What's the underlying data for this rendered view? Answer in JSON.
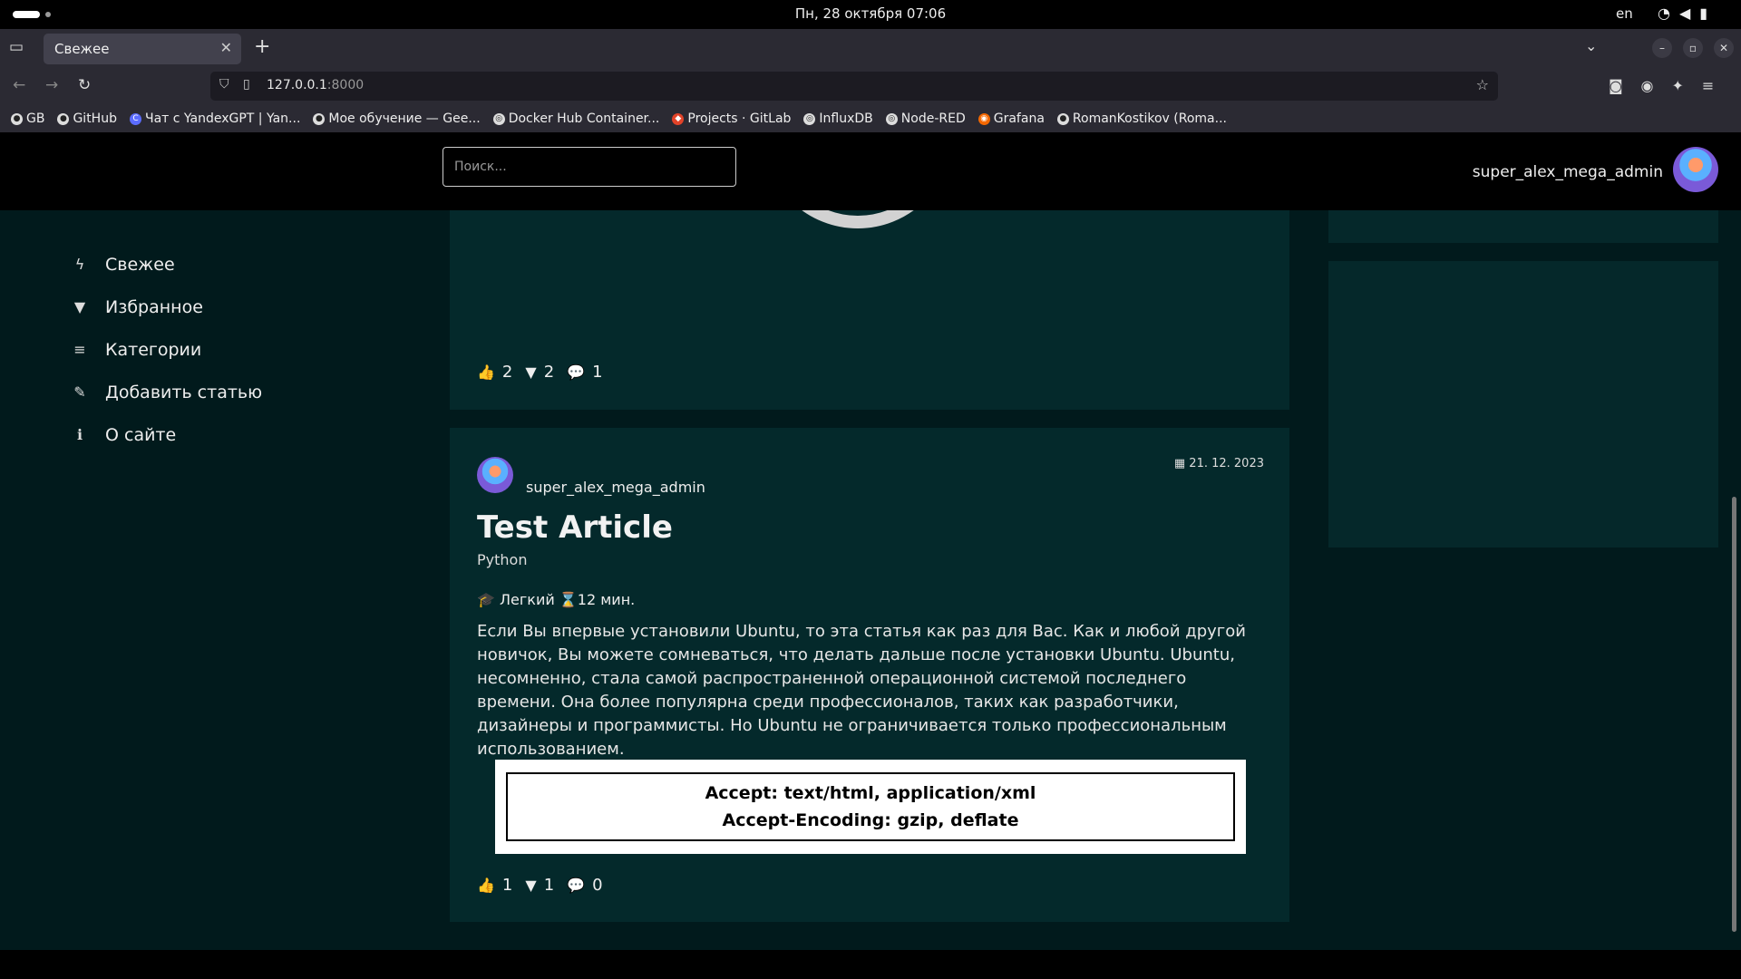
{
  "os": {
    "datetime": "Пн, 28 октября  07:06",
    "lang": "en"
  },
  "browser": {
    "tab_title": "Свежее",
    "url_host": "127.0.0.1",
    "url_port": ":8000",
    "bookmarks": [
      {
        "label": "GB"
      },
      {
        "label": "GitHub"
      },
      {
        "label": "Чат с YandexGPT | Yan..."
      },
      {
        "label": "Мое обучение — Gee..."
      },
      {
        "label": "Docker Hub Container..."
      },
      {
        "label": "Projects · GitLab"
      },
      {
        "label": "InfluxDB"
      },
      {
        "label": "Node-RED"
      },
      {
        "label": "Grafana"
      },
      {
        "label": "RomanKostikov (Roma..."
      }
    ]
  },
  "header": {
    "search_placeholder": "Поиск...",
    "username": "super_alex_mega_admin"
  },
  "sidebar": {
    "items": [
      {
        "label": "Свежее",
        "icon": "bolt-icon"
      },
      {
        "label": "Избранное",
        "icon": "bookmark-icon"
      },
      {
        "label": "Категории",
        "icon": "list-icon"
      },
      {
        "label": "Добавить статью",
        "icon": "pencil-icon"
      },
      {
        "label": "О сайте",
        "icon": "info-icon"
      }
    ]
  },
  "article1": {
    "likes": "2",
    "bookmarks": "2",
    "comments": "1"
  },
  "article2": {
    "author": "super_alex_mega_admin",
    "date": "21. 12. 2023",
    "title": "Test Article",
    "category": "Python",
    "difficulty": "Легкий",
    "read_time": "12 мин.",
    "text": "Если Вы впервые установили Ubuntu, то эта статья как раз для Вас. Как и любой другой новичок, Вы можете сомневаться, что делать дальше после установки Ubuntu. Ubuntu, несомненно, стала самой распространенной операционной системой последнего времени. Она более популярна среди профессионалов, таких как разработчики, дизайнеры и программисты. Но Ubuntu не ограничивается только профессиональным использованием.",
    "code_line1": "Accept: text/html, application/xml",
    "code_line2": "Accept-Encoding: gzip, deflate",
    "likes": "1",
    "bookmarks": "1",
    "comments": "0"
  }
}
